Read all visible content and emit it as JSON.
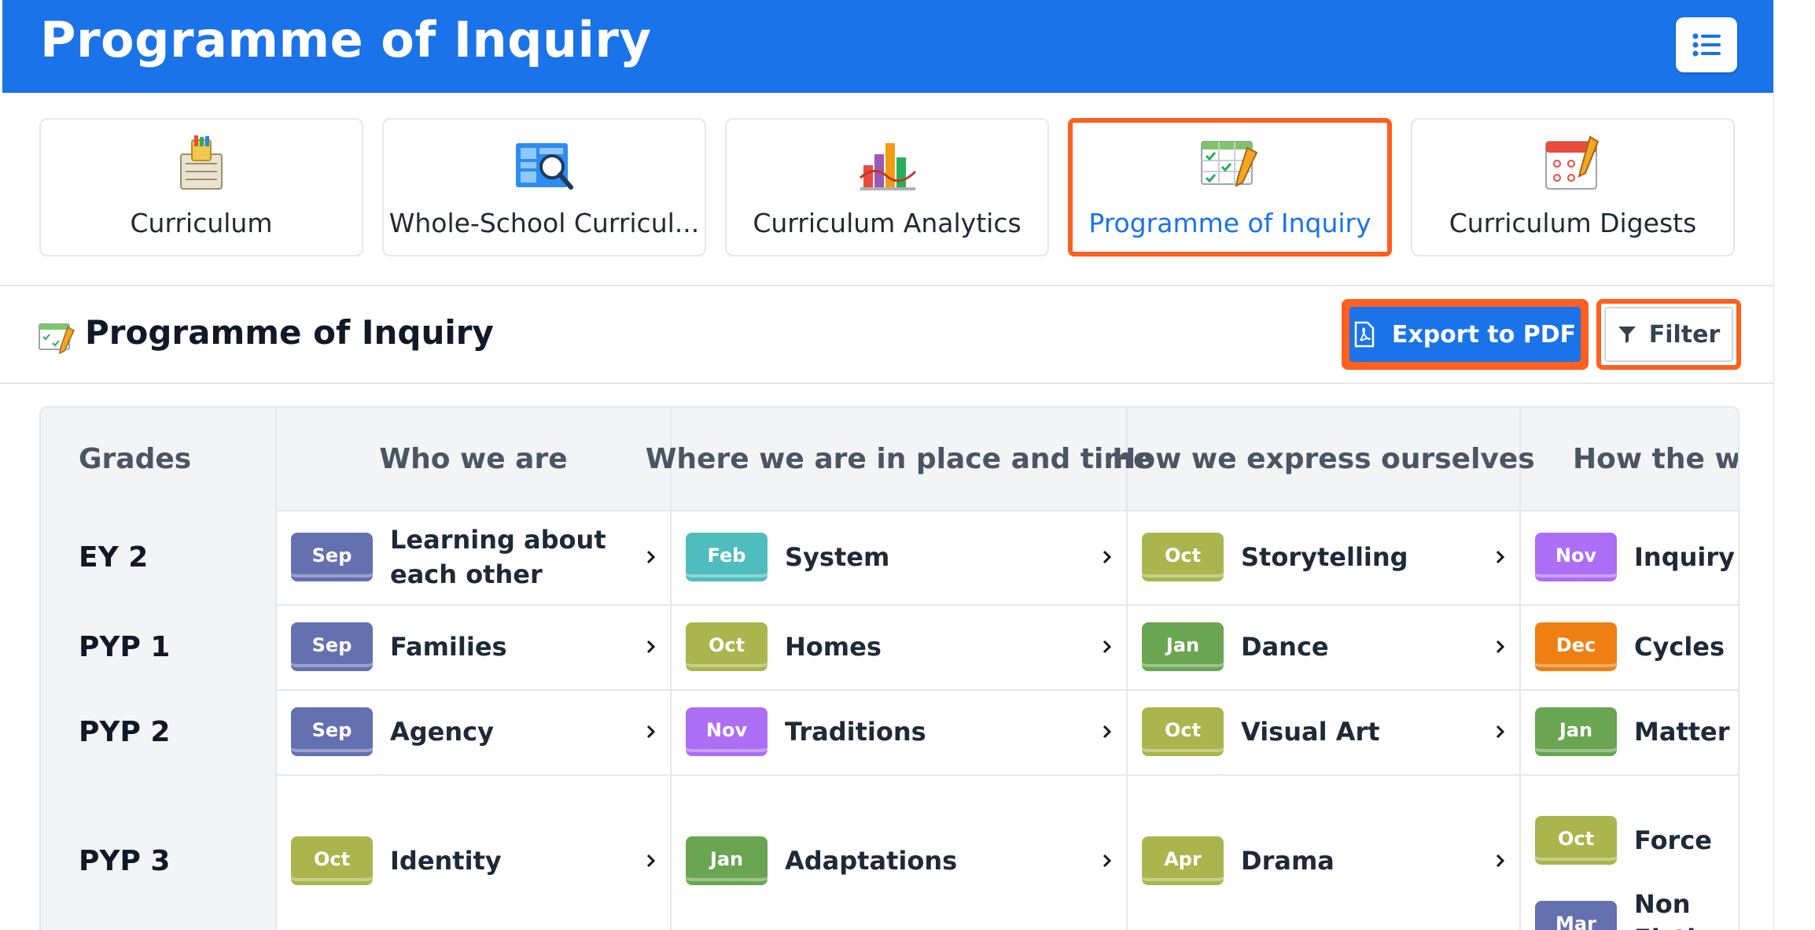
{
  "header": {
    "title": "Programme of Inquiry"
  },
  "nav": {
    "cards": [
      {
        "label": "Curriculum",
        "icon": "curriculum-icon"
      },
      {
        "label": "Whole-School Curricul...",
        "icon": "whole-school-curriculum-icon"
      },
      {
        "label": "Curriculum Analytics",
        "icon": "analytics-chart-icon"
      },
      {
        "label": "Programme of Inquiry",
        "icon": "programme-checklist-icon",
        "active": true
      },
      {
        "label": "Curriculum Digests",
        "icon": "calendar-icon"
      }
    ]
  },
  "section": {
    "title": "Programme of Inquiry",
    "export_label": "Export to PDF",
    "filter_label": "Filter"
  },
  "table": {
    "grades_header": "Grades",
    "columns": [
      "Who we are",
      "Where we are in place and time",
      "How we express ourselves",
      "How the wo"
    ],
    "rows": [
      {
        "grade": "EY 2",
        "cells": [
          [
            {
              "month": "Sep",
              "name": "Learning about each other"
            }
          ],
          [
            {
              "month": "Feb",
              "name": "System"
            }
          ],
          [
            {
              "month": "Oct",
              "name": "Storytelling"
            }
          ],
          [
            {
              "month": "Nov",
              "name": "Inquiry"
            }
          ]
        ]
      },
      {
        "grade": "PYP 1",
        "cells": [
          [
            {
              "month": "Sep",
              "name": "Families"
            }
          ],
          [
            {
              "month": "Oct",
              "name": "Homes"
            }
          ],
          [
            {
              "month": "Jan",
              "name": "Dance"
            }
          ],
          [
            {
              "month": "Dec",
              "name": "Cycles"
            }
          ]
        ]
      },
      {
        "grade": "PYP 2",
        "cells": [
          [
            {
              "month": "Sep",
              "name": "Agency"
            }
          ],
          [
            {
              "month": "Nov",
              "name": "Traditions"
            }
          ],
          [
            {
              "month": "Oct",
              "name": "Visual Art"
            }
          ],
          [
            {
              "month": "Jan",
              "name": "Matter"
            }
          ]
        ]
      },
      {
        "grade": "PYP 3",
        "cells": [
          [
            {
              "month": "Oct",
              "name": "Identity"
            }
          ],
          [
            {
              "month": "Jan",
              "name": "Adaptations"
            }
          ],
          [
            {
              "month": "Apr",
              "name": "Drama"
            }
          ],
          [
            {
              "month": "Oct",
              "name": "Force"
            },
            {
              "month": "Mar",
              "name": "Non Fiction Skills"
            }
          ]
        ]
      }
    ]
  },
  "month_colors": {
    "Sep": "#6470b0",
    "Feb": "#4fbdbe",
    "Oct": "#abb54e",
    "Nov": "#ac6ef5",
    "Jan": "#6aa552",
    "Dec": "#ef7f12",
    "Apr": "#abb54e",
    "Mar": "#6470b0"
  },
  "colors": {
    "accent": "#1a73e8",
    "highlight": "#ff5f1f"
  }
}
